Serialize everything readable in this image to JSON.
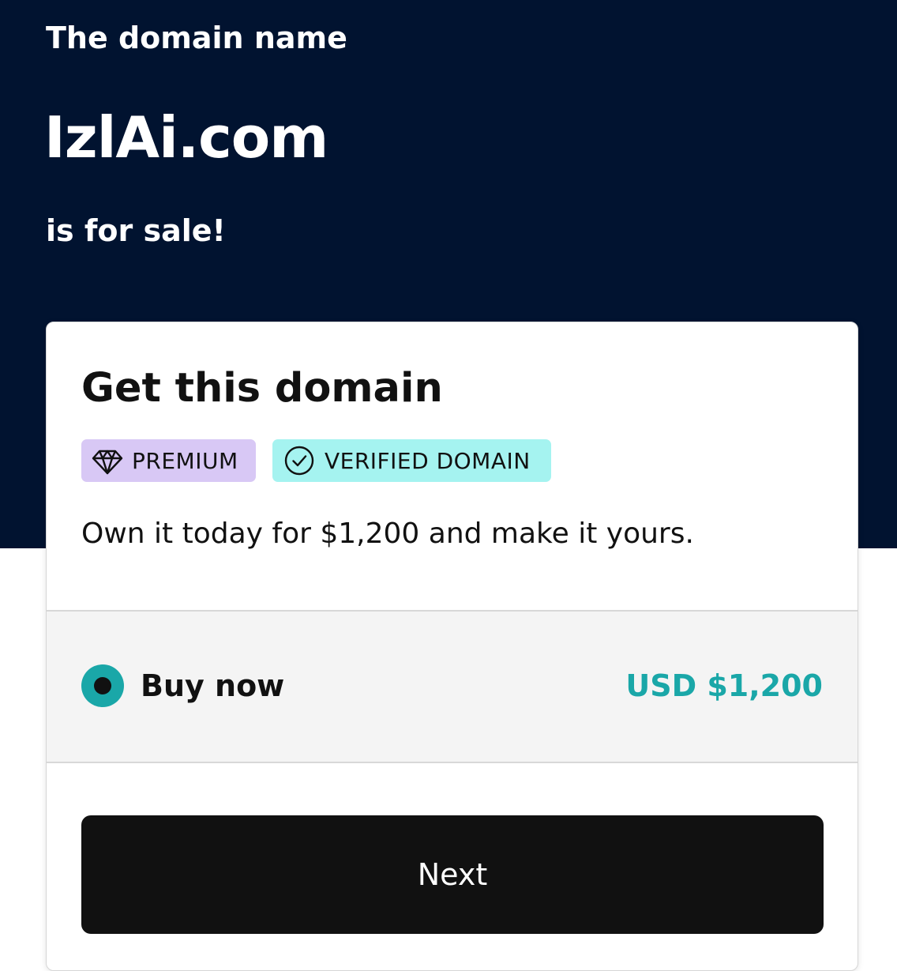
{
  "hero": {
    "intro": "The domain name",
    "domain": "IzlAi.com",
    "outro": "is for sale!"
  },
  "card": {
    "title": "Get this domain",
    "badges": {
      "premium": {
        "label": "PREMIUM",
        "icon": "diamond-icon",
        "color": "#d8c8f5"
      },
      "verified": {
        "label": "VERIFIED DOMAIN",
        "icon": "check-circle-icon",
        "color": "#a5f3f0"
      }
    },
    "pitch": "Own it today for $1,200 and make it yours.",
    "option": {
      "label": "Buy now",
      "price": "USD $1,200",
      "selected": true
    },
    "next_label": "Next"
  },
  "colors": {
    "hero_background": "#011330",
    "accent": "#1aa7a8",
    "button": "#111111"
  }
}
